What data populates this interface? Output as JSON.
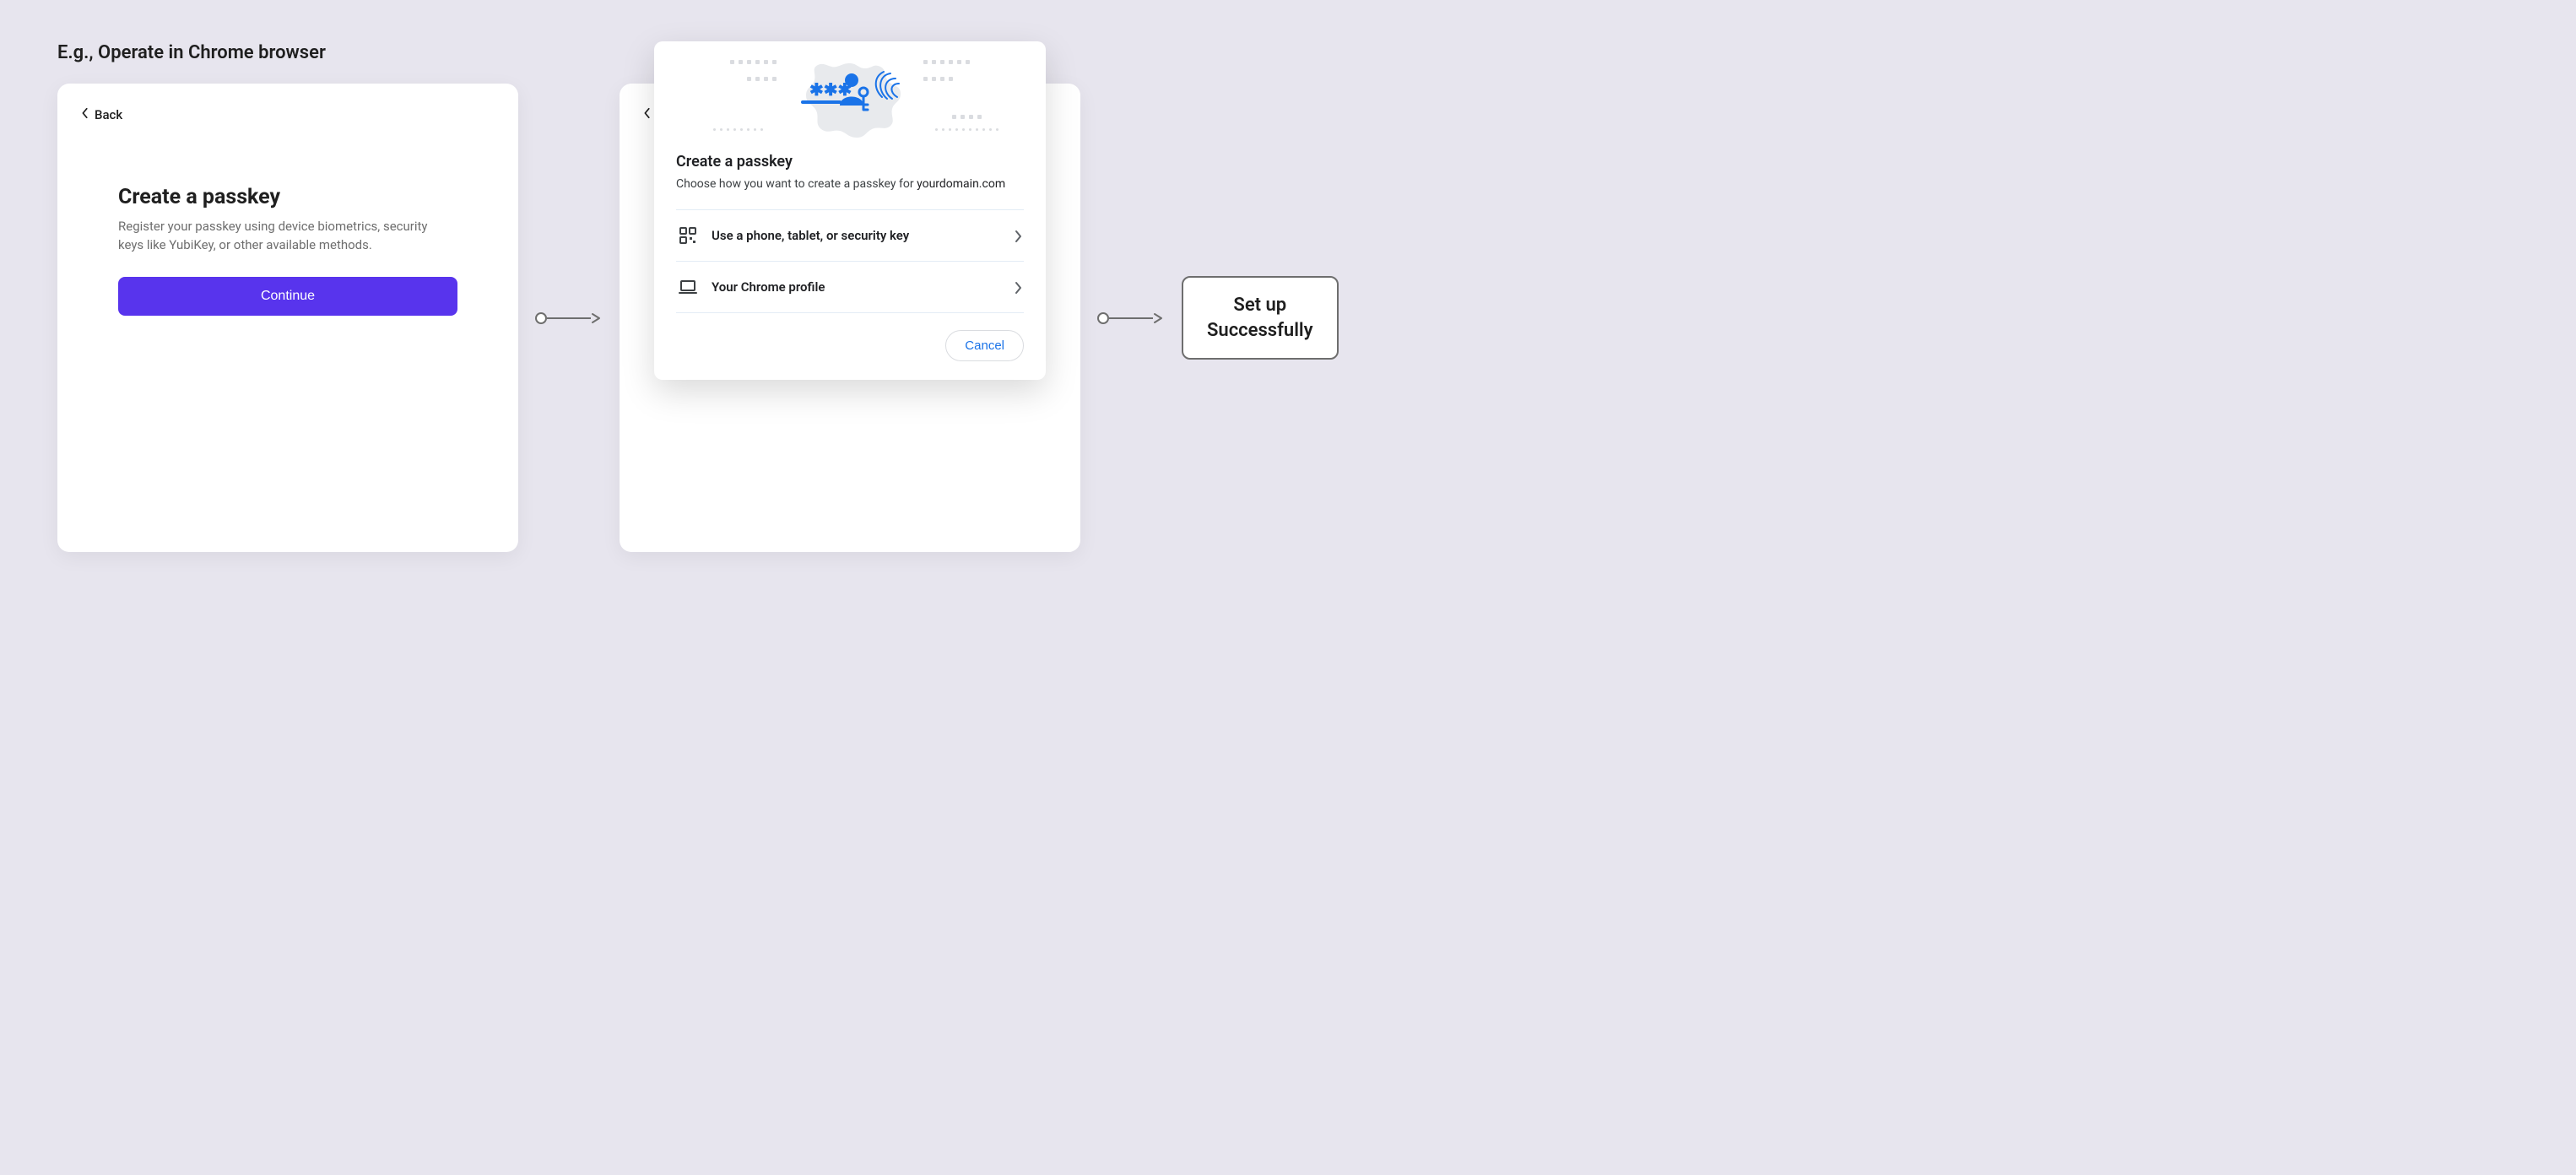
{
  "caption": "E.g., Operate in Chrome browser",
  "card1": {
    "back_label": "Back",
    "title": "Create a passkey",
    "subtitle": "Register your passkey using device biometrics, security keys like YubiKey, or other available methods.",
    "continue_label": "Continue"
  },
  "dialog": {
    "title": "Create a passkey",
    "subtitle_prefix": "Choose how you want to create a passkey for ",
    "domain": "yourdomain.com",
    "options": [
      {
        "icon": "qr-device-icon",
        "label": "Use a phone, tablet, or security key"
      },
      {
        "icon": "laptop-icon",
        "label": "Your Chrome profile"
      }
    ],
    "cancel_label": "Cancel"
  },
  "result_badge": {
    "line1": "Set up",
    "line2": "Successfully"
  }
}
